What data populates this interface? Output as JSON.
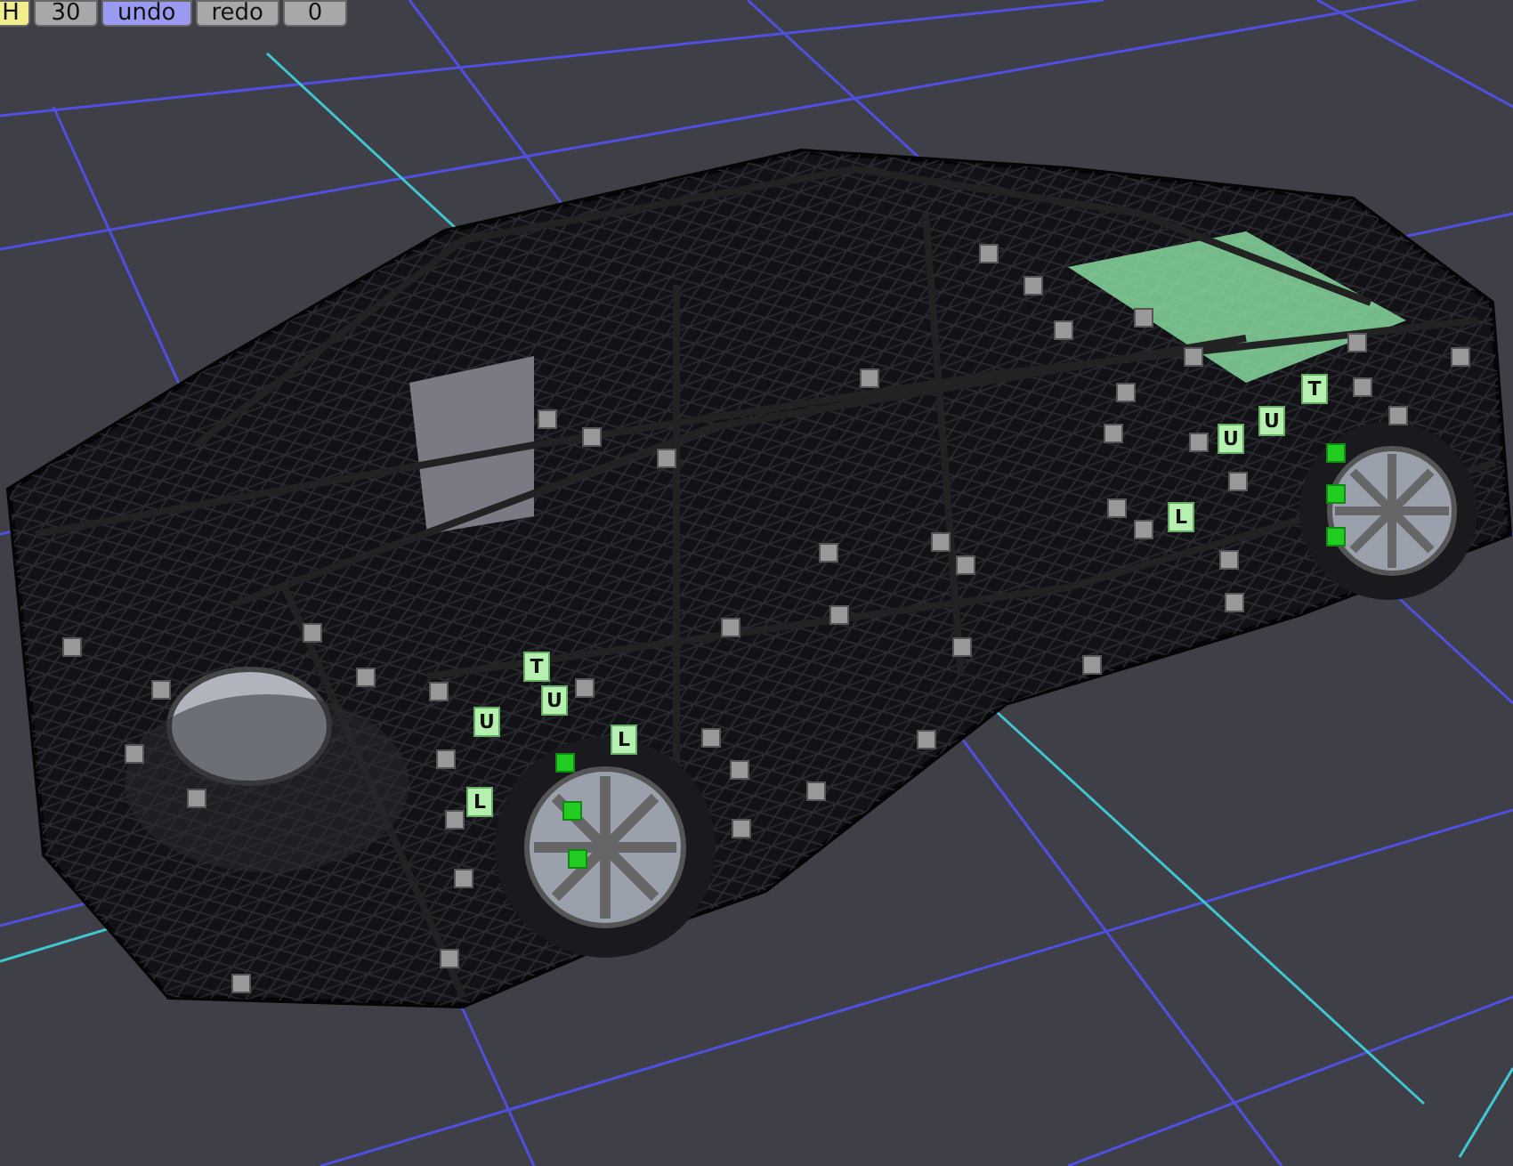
{
  "toolbar": [
    {
      "label": "H",
      "kind": "toggle",
      "selected": true
    },
    {
      "label": "30",
      "kind": "field",
      "selected": false
    },
    {
      "label": "undo",
      "kind": "button",
      "selected": true
    },
    {
      "label": "redo",
      "kind": "button",
      "selected": false
    },
    {
      "label": "0",
      "kind": "field",
      "selected": false
    }
  ],
  "handle_labels": [
    {
      "label": "T"
    },
    {
      "label": "U"
    },
    {
      "label": "U"
    },
    {
      "label": "L"
    },
    {
      "label": "L"
    },
    {
      "label": "T"
    },
    {
      "label": "U"
    },
    {
      "label": "U"
    },
    {
      "label": "L"
    }
  ],
  "control_points": [
    {
      "selected": false
    },
    {
      "selected": false
    },
    {
      "selected": false
    },
    {
      "selected": false
    },
    {
      "selected": false
    },
    {
      "selected": false
    },
    {
      "selected": false
    },
    {
      "selected": false
    },
    {
      "selected": false
    },
    {
      "selected": false
    },
    {
      "selected": false
    },
    {
      "selected": false
    },
    {
      "selected": false
    },
    {
      "selected": false
    },
    {
      "selected": false
    },
    {
      "selected": false
    },
    {
      "selected": false
    },
    {
      "selected": false
    },
    {
      "selected": false
    },
    {
      "selected": false
    },
    {
      "selected": false
    },
    {
      "selected": false
    },
    {
      "selected": false
    },
    {
      "selected": false
    },
    {
      "selected": false
    },
    {
      "selected": false
    },
    {
      "selected": false
    },
    {
      "selected": false
    },
    {
      "selected": false
    },
    {
      "selected": false
    },
    {
      "selected": false
    },
    {
      "selected": false
    },
    {
      "selected": false
    },
    {
      "selected": false
    },
    {
      "selected": false
    },
    {
      "selected": false
    },
    {
      "selected": false
    },
    {
      "selected": false
    },
    {
      "selected": false
    },
    {
      "selected": false
    },
    {
      "selected": false
    },
    {
      "selected": false
    },
    {
      "selected": false
    },
    {
      "selected": false
    },
    {
      "selected": false
    },
    {
      "selected": false
    },
    {
      "selected": true
    },
    {
      "selected": true
    },
    {
      "selected": true
    },
    {
      "selected": true
    },
    {
      "selected": true
    },
    {
      "selected": true
    }
  ]
}
